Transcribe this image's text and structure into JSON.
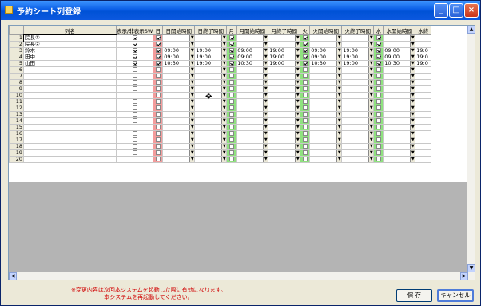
{
  "window": {
    "title": "予約シート列登録"
  },
  "colors": {
    "sunday": "#f49c9c",
    "weekday": "#8fe27f"
  },
  "headers": [
    "",
    "列名",
    "表示/非表示SW",
    "日",
    "日開始時間",
    "日終了時間",
    "月",
    "月開始時間",
    "月終了時間",
    "火",
    "火開始時間",
    "火終了時間",
    "水",
    "水開始時間",
    "水終"
  ],
  "rows": [
    {
      "n": "1",
      "name": "院長①",
      "show": true,
      "d": [
        [
          true,
          "",
          ""
        ],
        [
          true,
          "",
          ""
        ],
        [
          true,
          "",
          ""
        ],
        [
          true,
          "",
          ""
        ]
      ]
    },
    {
      "n": "2",
      "name": "院長②",
      "show": true,
      "d": [
        [
          true,
          "",
          ""
        ],
        [
          true,
          "",
          ""
        ],
        [
          true,
          "",
          ""
        ],
        [
          true,
          "",
          ""
        ]
      ]
    },
    {
      "n": "3",
      "name": "鈴木",
      "show": true,
      "d": [
        [
          true,
          "09:00",
          "19:00"
        ],
        [
          true,
          "09:00",
          "19:00"
        ],
        [
          true,
          "09:00",
          "19:00"
        ],
        [
          true,
          "09:00",
          "19:0"
        ]
      ]
    },
    {
      "n": "4",
      "name": "田中",
      "show": true,
      "d": [
        [
          true,
          "09:00",
          "19:00"
        ],
        [
          true,
          "09:00",
          "19:00"
        ],
        [
          true,
          "09:00",
          "19:00"
        ],
        [
          true,
          "09:00",
          "19:0"
        ]
      ]
    },
    {
      "n": "5",
      "name": "山田",
      "show": true,
      "d": [
        [
          true,
          "10:30",
          "19:00"
        ],
        [
          true,
          "10:30",
          "19:00"
        ],
        [
          true,
          "10:30",
          "19:00"
        ],
        [
          true,
          "10:30",
          "19:0"
        ]
      ]
    },
    {
      "n": "6",
      "name": "",
      "show": false,
      "d": [
        [
          false,
          "",
          ""
        ],
        [
          false,
          "",
          ""
        ],
        [
          false,
          "",
          ""
        ],
        [
          false,
          "",
          ""
        ]
      ]
    },
    {
      "n": "7",
      "name": "",
      "show": false,
      "d": [
        [
          false,
          "",
          ""
        ],
        [
          false,
          "",
          ""
        ],
        [
          false,
          "",
          ""
        ],
        [
          false,
          "",
          ""
        ]
      ]
    },
    {
      "n": "8",
      "name": "",
      "show": false,
      "d": [
        [
          false,
          "",
          ""
        ],
        [
          false,
          "",
          ""
        ],
        [
          false,
          "",
          ""
        ],
        [
          false,
          "",
          ""
        ]
      ]
    },
    {
      "n": "9",
      "name": "",
      "show": false,
      "d": [
        [
          false,
          "",
          ""
        ],
        [
          false,
          "",
          ""
        ],
        [
          false,
          "",
          ""
        ],
        [
          false,
          "",
          ""
        ]
      ]
    },
    {
      "n": "10",
      "name": "",
      "show": false,
      "d": [
        [
          false,
          "",
          ""
        ],
        [
          false,
          "",
          ""
        ],
        [
          false,
          "",
          ""
        ],
        [
          false,
          "",
          ""
        ]
      ]
    },
    {
      "n": "11",
      "name": "",
      "show": false,
      "d": [
        [
          false,
          "",
          ""
        ],
        [
          false,
          "",
          ""
        ],
        [
          false,
          "",
          ""
        ],
        [
          false,
          "",
          ""
        ]
      ]
    },
    {
      "n": "12",
      "name": "",
      "show": false,
      "d": [
        [
          false,
          "",
          ""
        ],
        [
          false,
          "",
          ""
        ],
        [
          false,
          "",
          ""
        ],
        [
          false,
          "",
          ""
        ]
      ]
    },
    {
      "n": "13",
      "name": "",
      "show": false,
      "d": [
        [
          false,
          "",
          ""
        ],
        [
          false,
          "",
          ""
        ],
        [
          false,
          "",
          ""
        ],
        [
          false,
          "",
          ""
        ]
      ]
    },
    {
      "n": "14",
      "name": "",
      "show": false,
      "d": [
        [
          false,
          "",
          ""
        ],
        [
          false,
          "",
          ""
        ],
        [
          false,
          "",
          ""
        ],
        [
          false,
          "",
          ""
        ]
      ]
    },
    {
      "n": "15",
      "name": "",
      "show": false,
      "d": [
        [
          false,
          "",
          ""
        ],
        [
          false,
          "",
          ""
        ],
        [
          false,
          "",
          ""
        ],
        [
          false,
          "",
          ""
        ]
      ]
    },
    {
      "n": "16",
      "name": "",
      "show": false,
      "d": [
        [
          false,
          "",
          ""
        ],
        [
          false,
          "",
          ""
        ],
        [
          false,
          "",
          ""
        ],
        [
          false,
          "",
          ""
        ]
      ]
    },
    {
      "n": "17",
      "name": "",
      "show": false,
      "d": [
        [
          false,
          "",
          ""
        ],
        [
          false,
          "",
          ""
        ],
        [
          false,
          "",
          ""
        ],
        [
          false,
          "",
          ""
        ]
      ]
    },
    {
      "n": "18",
      "name": "",
      "show": false,
      "d": [
        [
          false,
          "",
          ""
        ],
        [
          false,
          "",
          ""
        ],
        [
          false,
          "",
          ""
        ],
        [
          false,
          "",
          ""
        ]
      ]
    },
    {
      "n": "19",
      "name": "",
      "show": false,
      "d": [
        [
          false,
          "",
          ""
        ],
        [
          false,
          "",
          ""
        ],
        [
          false,
          "",
          ""
        ],
        [
          false,
          "",
          ""
        ]
      ]
    },
    {
      "n": "20",
      "name": "",
      "show": false,
      "d": [
        [
          false,
          "",
          ""
        ],
        [
          false,
          "",
          ""
        ],
        [
          false,
          "",
          ""
        ],
        [
          false,
          "",
          ""
        ]
      ]
    }
  ],
  "footer": {
    "notice_line1": "※変更内容は次回本システムを起動した際に有効になります。",
    "notice_line2": "本システムを再起動してください。",
    "save_label": "保 存",
    "cancel_label": "キャンセル"
  },
  "icons": {
    "minimize": "minimize-icon",
    "maximize": "maximize-icon",
    "close": "close-icon"
  }
}
